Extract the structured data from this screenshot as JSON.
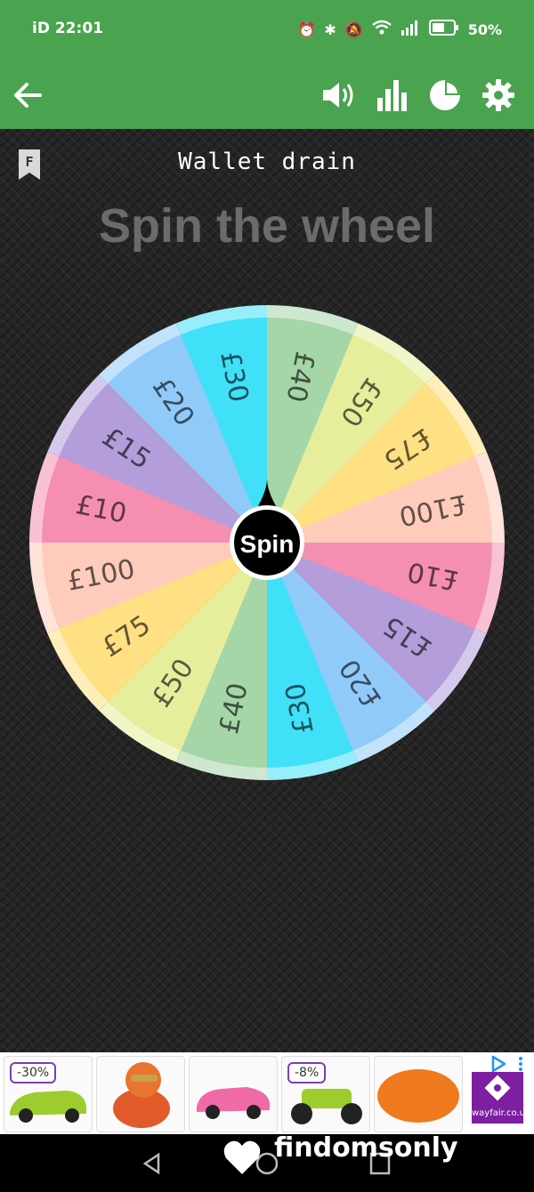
{
  "status_bar": {
    "time": "iD 22:01",
    "battery": "50%",
    "icons": [
      "nfc-icon",
      "alarm-icon",
      "bluetooth-icon",
      "mute-icon",
      "wifi-icon",
      "signal-icon",
      "battery-icon"
    ]
  },
  "app_bar": {
    "icons": [
      "back-arrow-icon",
      "volume-icon",
      "stats-icon",
      "pie-icon",
      "settings-icon"
    ],
    "color": "#4aa34f"
  },
  "wheel": {
    "badge": "F",
    "name": "Wallet drain",
    "heading": "Spin the wheel",
    "spin_label": "Spin",
    "segments": [
      {
        "label": "£40",
        "color": "#a5d6a7"
      },
      {
        "label": "£50",
        "color": "#e6ee9c"
      },
      {
        "label": "£75",
        "color": "#ffe082"
      },
      {
        "label": "£100",
        "color": "#ffccbc"
      },
      {
        "label": "£10",
        "color": "#f48fb1"
      },
      {
        "label": "£15",
        "color": "#b39ddb"
      },
      {
        "label": "£20",
        "color": "#90caf9"
      },
      {
        "label": "£30",
        "color": "#40e0f8"
      },
      {
        "label": "£40",
        "color": "#a5d6a7"
      },
      {
        "label": "£50",
        "color": "#e6ee9c"
      },
      {
        "label": "£75",
        "color": "#ffe082"
      },
      {
        "label": "£100",
        "color": "#ffccbc"
      },
      {
        "label": "£10",
        "color": "#f48fb1"
      },
      {
        "label": "£15",
        "color": "#b39ddb"
      },
      {
        "label": "£20",
        "color": "#90caf9"
      },
      {
        "label": "£30",
        "color": "#40e0f8"
      }
    ]
  },
  "ad": {
    "discount_1": "-30%",
    "discount_2": "-8%",
    "brand": "wayfair.co.uk"
  },
  "watermark": "findomsonly"
}
